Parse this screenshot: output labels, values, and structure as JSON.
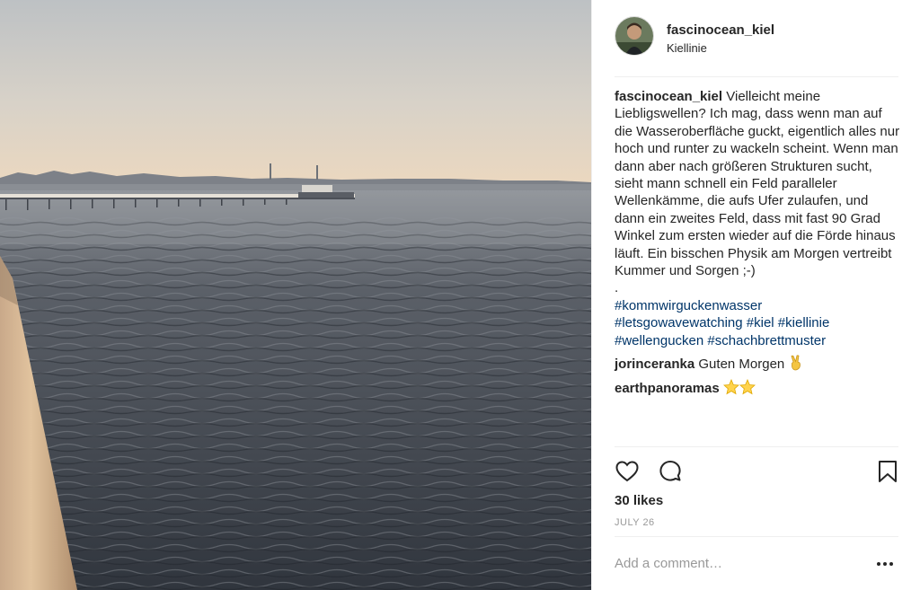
{
  "post": {
    "image_alt": "Kiel Förde water view",
    "username": "fascinocean_kiel",
    "location": "Kiellinie"
  },
  "caption": {
    "username": "fascinocean_kiel",
    "text": "Vielleicht meine Liebligswellen? Ich mag, dass wenn man auf die Wasseroberfläche guckt, eigentlich alles nur hoch und runter zu wackeln scheint. Wenn man dann aber nach größeren Strukturen sucht, sieht mann schnell ein Feld paralleler Wellenkämme, die aufs Ufer zulaufen, und dann ein zweites Feld, dass mit fast 90 Grad Winkel zum ersten wieder auf die Förde hinaus läuft. Ein bisschen Physik am Morgen vertreibt Kummer und Sorgen ;-)",
    "dot": ".",
    "hashtags": [
      "#kommwirguckenwasser",
      "#letsgowavewatching",
      "#kiel",
      "#kiellinie",
      "#wellengucken",
      "#schachbrettmuster"
    ]
  },
  "comments": [
    {
      "username": "jorinceranka",
      "text": "Guten Morgen",
      "emoji": "victory-hand"
    },
    {
      "username": "earthpanoramas",
      "text": "",
      "emoji": "two-stars"
    }
  ],
  "actions": {
    "like_icon": "heart-outline-icon",
    "comment_icon": "speech-bubble-icon",
    "save_icon": "bookmark-outline-icon"
  },
  "likes": "30 likes",
  "date": "JULY 26",
  "add_comment": {
    "placeholder": "Add a comment…"
  },
  "colors": {
    "text": "#262626",
    "hashtag": "#003569",
    "muted": "#999999",
    "border": "#efefef"
  }
}
